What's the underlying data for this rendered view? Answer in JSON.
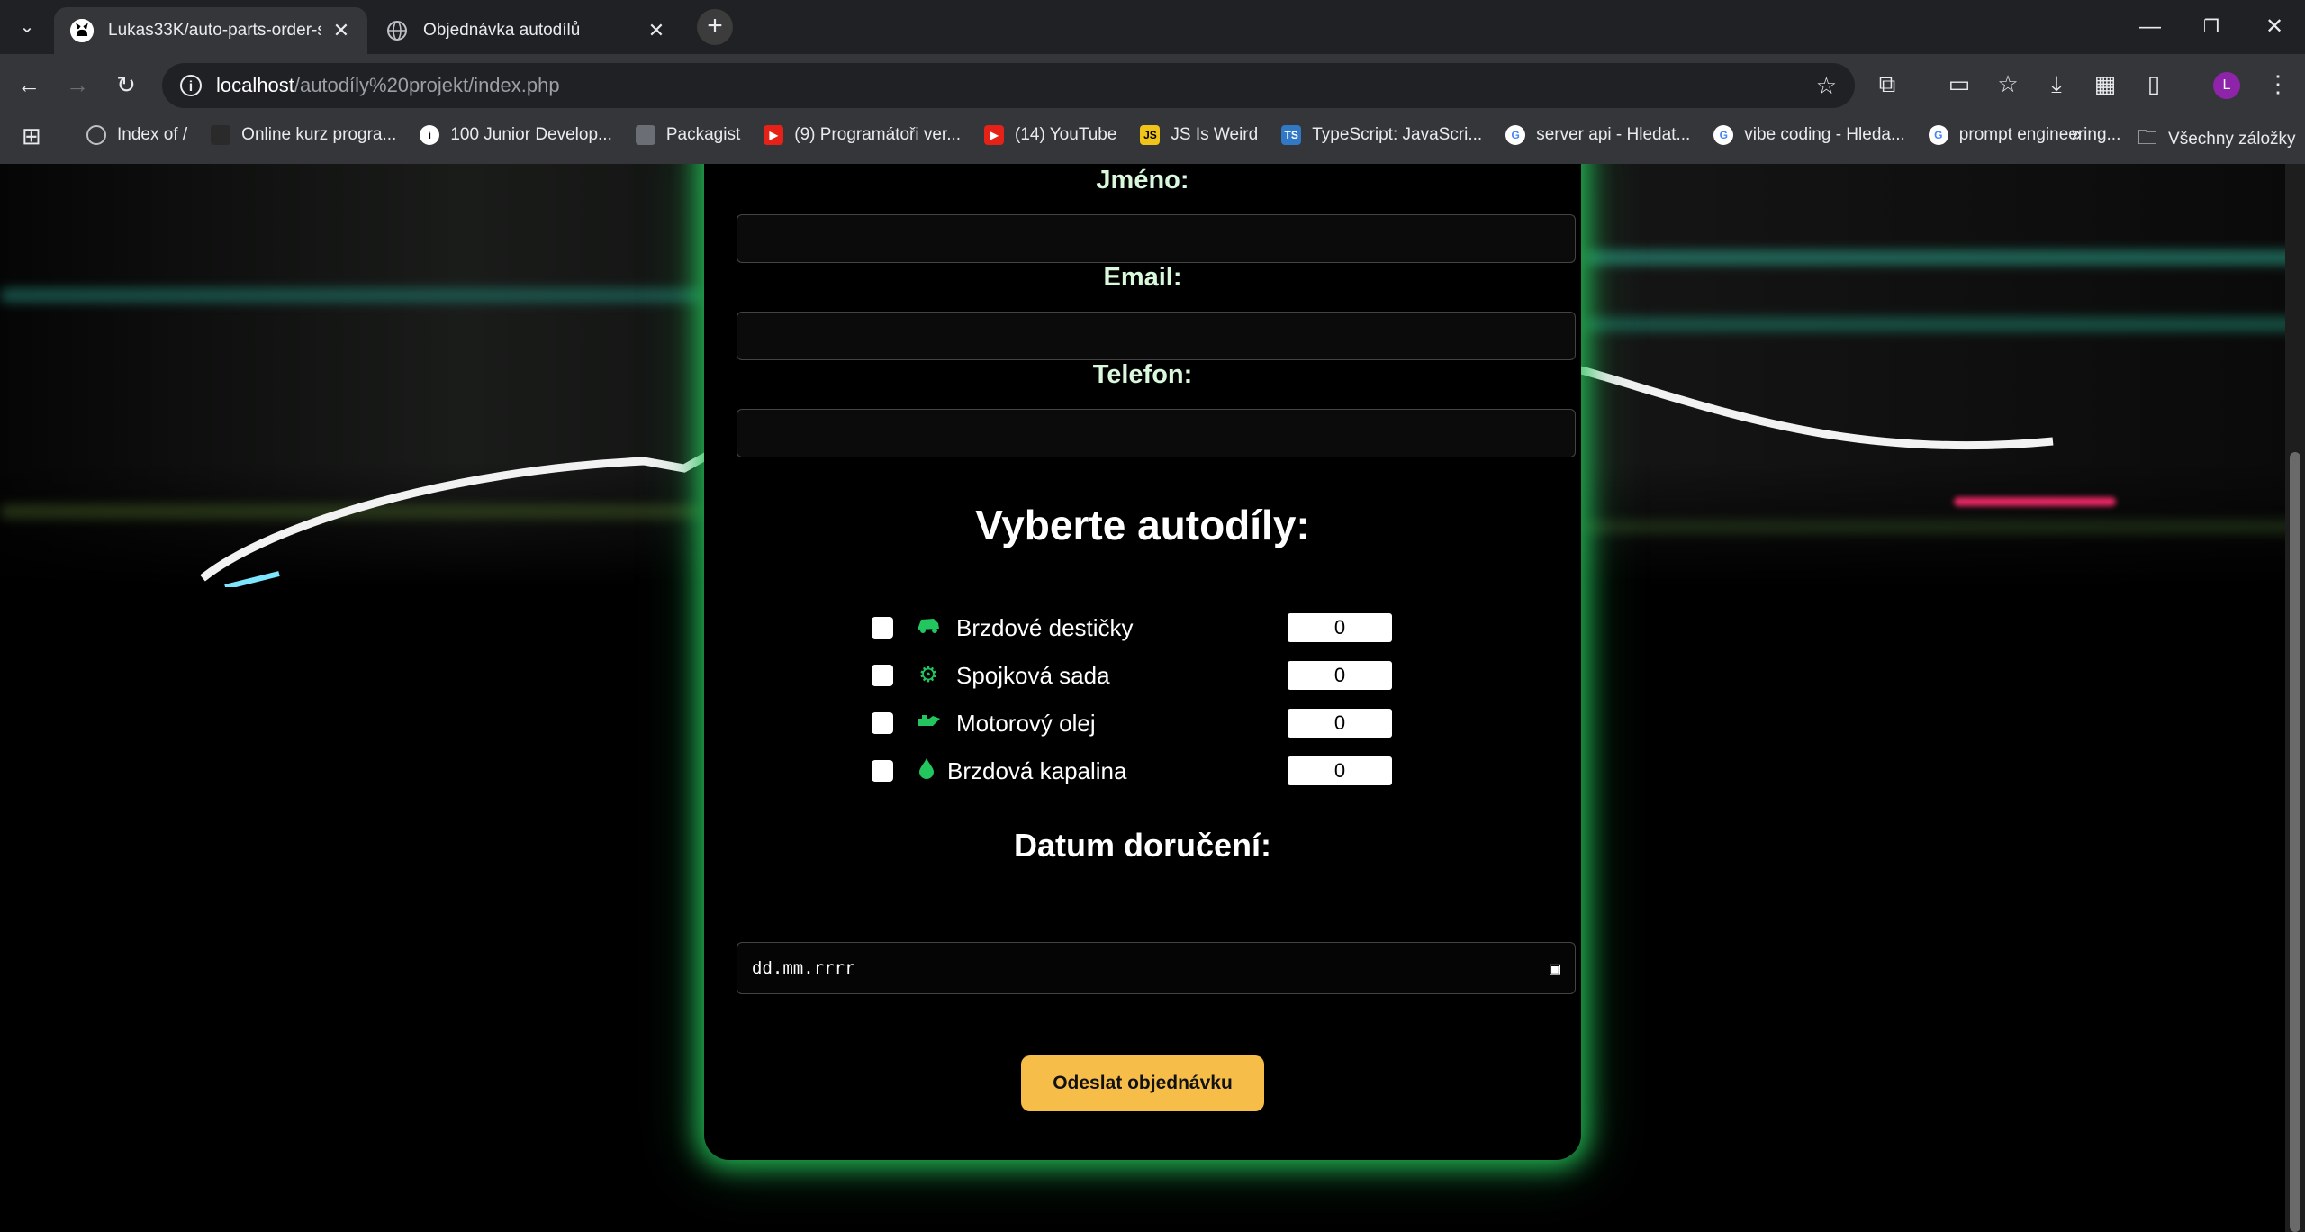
{
  "browser": {
    "tabs": [
      {
        "title": "Lukas33K/auto-parts-order-syst",
        "icon": "github-icon"
      },
      {
        "title": "Objednávka autodílů",
        "icon": "globe-icon"
      }
    ],
    "url_host": "localhost",
    "url_path": "/autodíly%20projekt/index.php",
    "avatar_letter": "L",
    "bookmarks": [
      "Index of /",
      "Online kurz progra...",
      "100 Junior Develop...",
      "Packagist",
      "(9) Programátoři ver...",
      "(14) YouTube",
      "JS Is Weird",
      "TypeScript: JavaScri...",
      "server api - Hledat...",
      "vibe coding - Hleda...",
      "prompt engineering..."
    ],
    "all_bookmarks": "Všechny záložky"
  },
  "form": {
    "name_label": "Jméno:",
    "email_label": "Email:",
    "phone_label": "Telefon:",
    "parts_heading": "Vyberte autodíly:",
    "parts": [
      {
        "name": "Brzdové destičky",
        "qty": "0",
        "icon": "car-icon"
      },
      {
        "name": "Spojková sada",
        "qty": "0",
        "icon": "gears-icon"
      },
      {
        "name": "Motorový olej",
        "qty": "0",
        "icon": "oil-can-icon"
      },
      {
        "name": "Brzdová kapalina",
        "qty": "0",
        "icon": "droplet-icon"
      }
    ],
    "date_heading": "Datum doručení:",
    "date_placeholder": "dd.mm.rrrr",
    "submit_label": "Odeslat objednávku"
  },
  "colors": {
    "accent_green": "#22c55e",
    "submit_yellow": "#f6bd49"
  }
}
